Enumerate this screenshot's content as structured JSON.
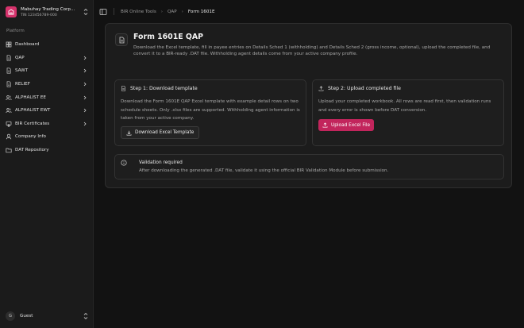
{
  "company": {
    "name": "Mabuhay Trading Corp...",
    "tin": "TIN 123456789-000"
  },
  "sidebar": {
    "group_label": "Platform",
    "items": [
      {
        "label": "Dashboard",
        "icon": "grid-icon",
        "chevron": false
      },
      {
        "label": "QAP",
        "icon": "document-icon",
        "chevron": true
      },
      {
        "label": "SAWT",
        "icon": "document-icon",
        "chevron": true
      },
      {
        "label": "RELIEF",
        "icon": "document-icon",
        "chevron": true
      },
      {
        "label": "ALPHALIST EE",
        "icon": "users-icon",
        "chevron": true
      },
      {
        "label": "ALPHALIST EWT",
        "icon": "users-icon",
        "chevron": true
      },
      {
        "label": "BIR Certificates",
        "icon": "certificate-icon",
        "chevron": true
      },
      {
        "label": "Company Info",
        "icon": "user-icon",
        "chevron": false
      },
      {
        "label": "DAT Repository",
        "icon": "folder-icon",
        "chevron": false
      }
    ]
  },
  "user": {
    "initial": "G",
    "name": "Guest"
  },
  "breadcrumb": [
    "BIR Online Tools",
    "QAP",
    "Form 1601E"
  ],
  "page": {
    "title": "Form 1601E QAP",
    "description": "Download the Excel template, fill in payee entries on Details Sched 1 (withholding) and Details Sched 2 (gross income, optional), upload the completed file, and convert it to a BIR-ready .DAT file. Withholding agent details come from your active company profile."
  },
  "step1": {
    "title": "Step 1: Download template",
    "body": "Download the Form 1601E QAP Excel template with example detail rows on two schedule sheets. Only .xlsx files are supported. Withholding agent information is taken from your active company.",
    "button": "Download Excel Template"
  },
  "step2": {
    "title": "Step 2: Upload completed file",
    "body": "Upload your completed workbook. All rows are read first, then validation runs and every error is shown before DAT conversion.",
    "button": "Upload Excel File"
  },
  "notice": {
    "title": "Validation required",
    "body": "After downloading the generated .DAT file, validate it using the official BIR Validation Module before submission."
  },
  "colors": {
    "accent": "#c2255c",
    "brand": "#d6336c",
    "background": "#121212"
  }
}
